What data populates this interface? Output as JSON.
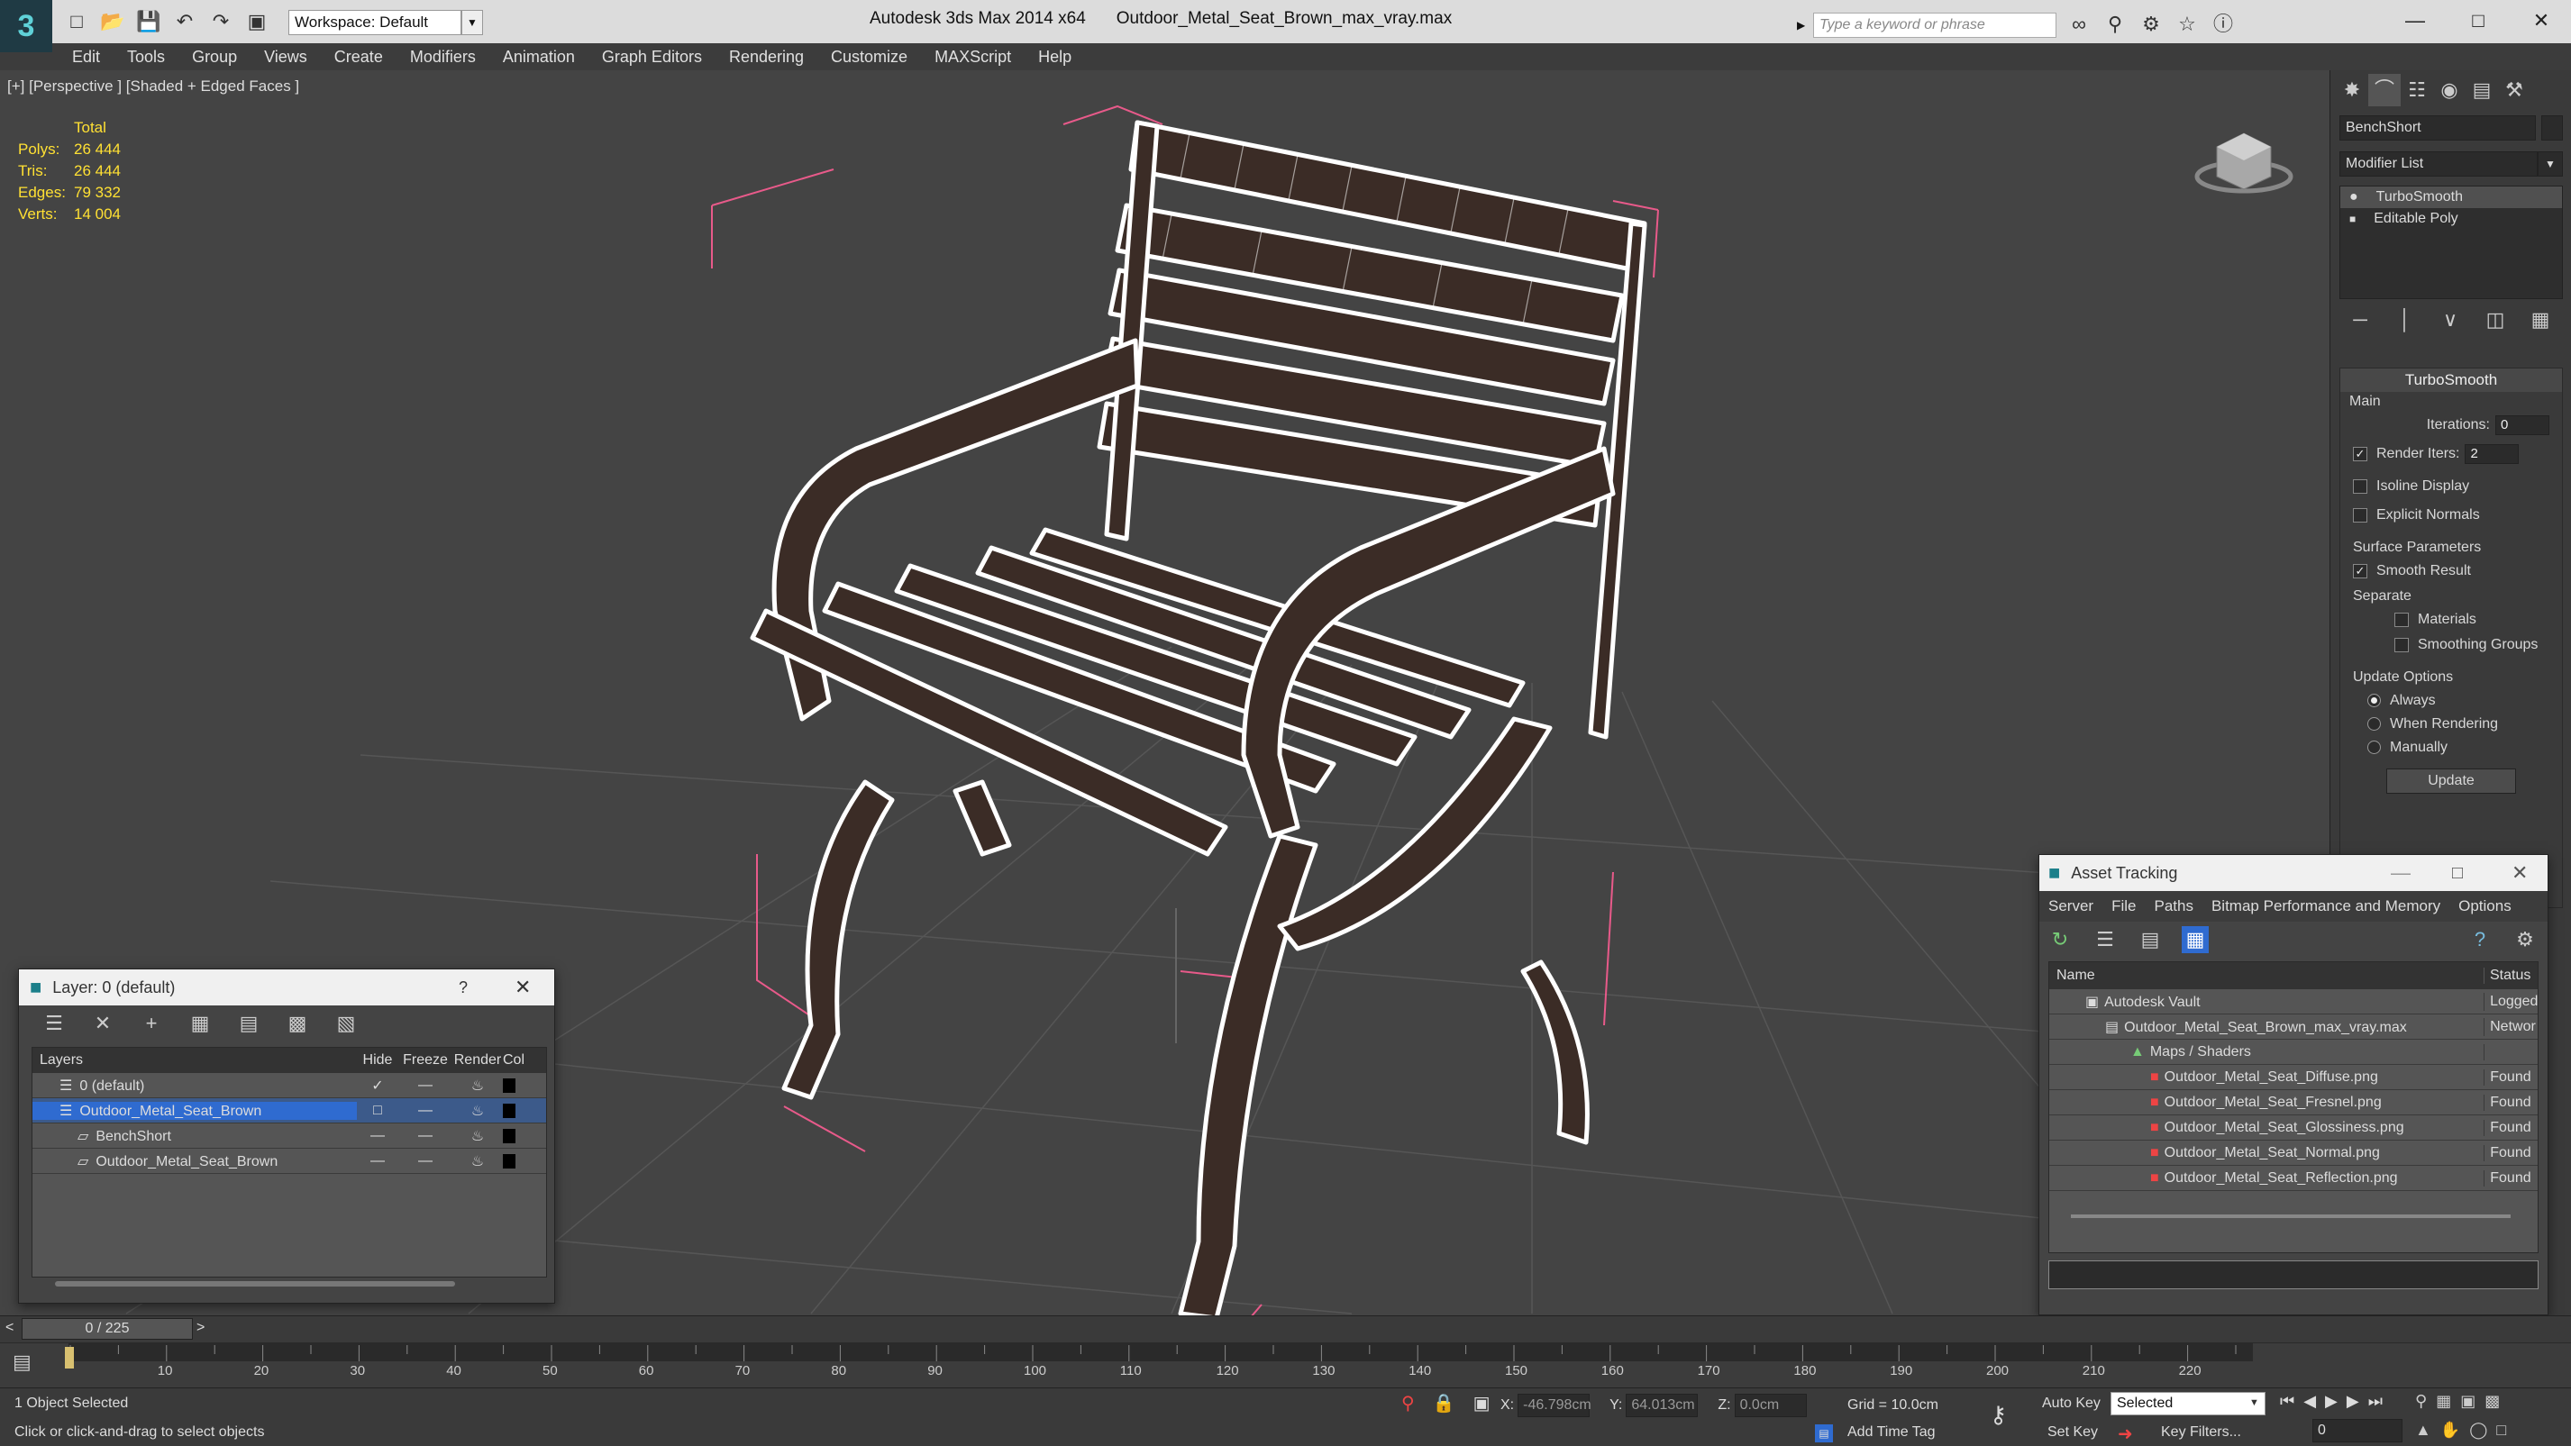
{
  "titlebar": {
    "workspace": "Workspace: Default",
    "app_name": "Autodesk 3ds Max  2014 x64",
    "file_name": "Outdoor_Metal_Seat_Brown_max_vray.max",
    "search_placeholder": "Type a keyword or phrase"
  },
  "menu": [
    "Edit",
    "Tools",
    "Group",
    "Views",
    "Create",
    "Modifiers",
    "Animation",
    "Graph Editors",
    "Rendering",
    "Customize",
    "MAXScript",
    "Help"
  ],
  "viewport": {
    "label": "[+] [Perspective ] [Shaded + Edged Faces ]",
    "stats_title": "Total",
    "stats": [
      {
        "label": "Polys:",
        "value": "26 444"
      },
      {
        "label": "Tris:",
        "value": "26 444"
      },
      {
        "label": "Edges:",
        "value": "79 332"
      },
      {
        "label": "Verts:",
        "value": "14 004"
      }
    ]
  },
  "command_panel": {
    "object_name": "BenchShort",
    "modifier_list": "Modifier List",
    "stack": [
      "TurboSmooth",
      "Editable Poly"
    ],
    "rollout_title": "TurboSmooth",
    "main_label": "Main",
    "iterations_label": "Iterations:",
    "iterations_value": "0",
    "render_iters_label": "Render Iters:",
    "render_iters_value": "2",
    "isoline": "Isoline Display",
    "explicit_normals": "Explicit Normals",
    "surface_params": "Surface Parameters",
    "smooth_result": "Smooth Result",
    "separate": "Separate",
    "materials": "Materials",
    "smoothing_groups": "Smoothing Groups",
    "update_options": "Update Options",
    "always": "Always",
    "when_rendering": "When Rendering",
    "manually": "Manually",
    "update_button": "Update"
  },
  "layer_window": {
    "title": "Layer: 0 (default)",
    "help": "?",
    "columns": [
      "Layers",
      "Hide",
      "Freeze",
      "Render",
      "Col"
    ],
    "rows": [
      {
        "name": "0 (default)",
        "indent": 0
      },
      {
        "name": "Outdoor_Metal_Seat_Brown",
        "indent": 0
      },
      {
        "name": "BenchShort",
        "indent": 1
      },
      {
        "name": "Outdoor_Metal_Seat_Brown",
        "indent": 1
      }
    ]
  },
  "asset_window": {
    "title": "Asset Tracking",
    "menu": [
      "Server",
      "File",
      "Paths",
      "Bitmap Performance and Memory",
      "Options"
    ],
    "columns": [
      "Name",
      "Status"
    ],
    "rows": [
      {
        "name": "Autodesk Vault",
        "status": "Logged",
        "indent": 1
      },
      {
        "name": "Outdoor_Metal_Seat_Brown_max_vray.max",
        "status": "Networ",
        "indent": 2
      },
      {
        "name": "Maps / Shaders",
        "status": "",
        "indent": 3
      },
      {
        "name": "Outdoor_Metal_Seat_Diffuse.png",
        "status": "Found",
        "indent": 4
      },
      {
        "name": "Outdoor_Metal_Seat_Fresnel.png",
        "status": "Found",
        "indent": 4
      },
      {
        "name": "Outdoor_Metal_Seat_Glossiness.png",
        "status": "Found",
        "indent": 4
      },
      {
        "name": "Outdoor_Metal_Seat_Normal.png",
        "status": "Found",
        "indent": 4
      },
      {
        "name": "Outdoor_Metal_Seat_Reflection.png",
        "status": "Found",
        "indent": 4
      }
    ]
  },
  "timeline": {
    "frame": "0 / 225",
    "ticks": [
      "10",
      "20",
      "30",
      "40",
      "50",
      "60",
      "70",
      "80",
      "90",
      "100",
      "110",
      "120",
      "130",
      "140",
      "150",
      "160",
      "170",
      "180",
      "190",
      "200",
      "210",
      "220"
    ]
  },
  "status": {
    "selected": "1 Object Selected",
    "prompt": "Click or click-and-drag to select objects",
    "x_label": "X:",
    "x_value": "-46.798cm",
    "y_label": "Y:",
    "y_value": "64.013cm",
    "z_label": "Z:",
    "z_value": "0.0cm",
    "grid": "Grid = 10.0cm",
    "add_time_tag": "Add Time Tag",
    "auto_key": "Auto Key",
    "set_key": "Set Key",
    "selected_dropdown": "Selected",
    "key_filters": "Key Filters...",
    "frame_field": "0"
  }
}
